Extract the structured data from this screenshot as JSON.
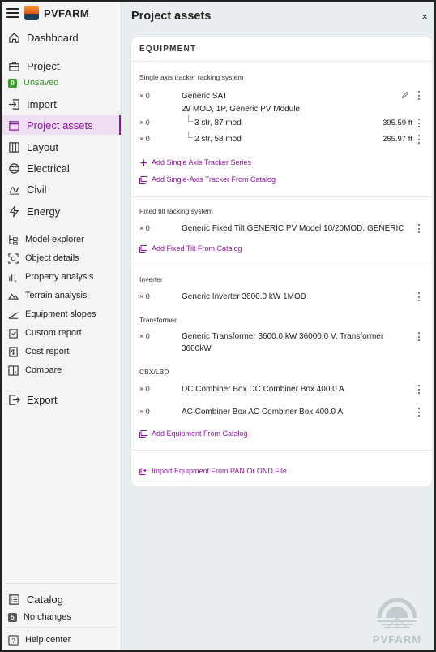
{
  "brand": {
    "name": "PVFARM"
  },
  "sidebar": {
    "dashboard": "Dashboard",
    "project": "Project",
    "project_status": "Unsaved",
    "project_status_count": "0",
    "import": "Import",
    "project_assets": "Project assets",
    "layout": "Layout",
    "electrical": "Electrical",
    "civil": "Civil",
    "energy": "Energy",
    "model_explorer": "Model explorer",
    "object_details": "Object details",
    "property_analysis": "Property analysis",
    "terrain_analysis": "Terrain analysis",
    "equipment_slopes": "Equipment slopes",
    "custom_report": "Custom report",
    "cost_report": "Cost report",
    "compare": "Compare",
    "export": "Export",
    "catalog": "Catalog",
    "catalog_status": "No changes",
    "catalog_count": "5",
    "help_center": "Help center"
  },
  "main": {
    "title": "Project assets",
    "close": "×",
    "card_title": "EQUIPMENT",
    "sat": {
      "label": "Single axis tracker racking system",
      "qty": "× 0",
      "name_line1": "Generic SAT",
      "name_line2": "29 MOD, 1P, Generic PV Module",
      "rows": [
        {
          "qty": "× 0",
          "desc": "3 str, 87 mod",
          "len": "395.59 ft"
        },
        {
          "qty": "× 0",
          "desc": "2 str, 58 mod",
          "len": "265.97 ft"
        }
      ],
      "add_series": "Add Single Axis Tracker Series",
      "add_catalog": "Add Single-Axis Tracker From Catalog"
    },
    "fixed": {
      "label": "Fixed tilt racking system",
      "qty": "× 0",
      "name": "Generic Fixed Tilt GENERIC PV Model 10/20MOD, GENERIC",
      "add_catalog": "Add Fixed Tilt From Catalog"
    },
    "inverter": {
      "label": "Inverter",
      "qty": "× 0",
      "name": "Generic Inverter 3600.0 kW 1MOD"
    },
    "transformer": {
      "label": "Transformer",
      "qty": "× 0",
      "name_line1": "Generic Transformer 3600.0 kW 36000.0 V, Transformer",
      "name_line2": "3600kW"
    },
    "cbx": {
      "label": "CBX/LBD",
      "rows": [
        {
          "qty": "× 0",
          "name": "DC Combiner Box DC Combiner Box 400.0 A"
        },
        {
          "qty": "× 0",
          "name": "AC Combiner Box AC Combiner Box 400.0 A"
        }
      ],
      "add_catalog": "Add Equipment From Catalog"
    },
    "import_link": "Import Equipment From PAN Or OND File"
  },
  "watermark": {
    "text": "PVFARM"
  },
  "colors": {
    "accent": "#8a1a9b",
    "success": "#3a9a2a",
    "background": "#e9eef0"
  }
}
